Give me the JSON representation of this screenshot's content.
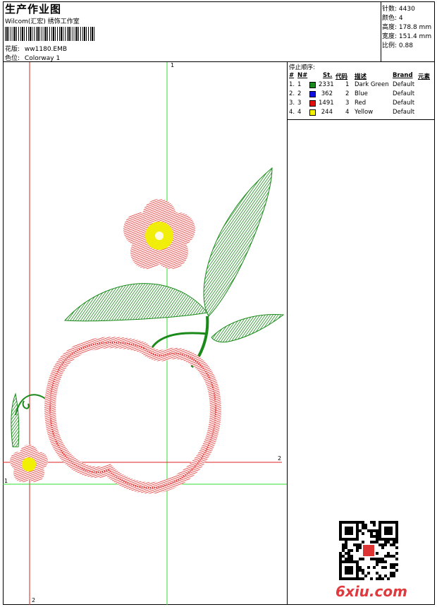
{
  "header": {
    "title": "生产作业图",
    "subtitle": "Wilcom(汇宏) 绣饰工作室",
    "design_label": "花版:",
    "design_value": "ww1180.EMB",
    "colorway_label": "色位:",
    "colorway_value": "Colorway 1"
  },
  "stats": {
    "stitches_label": "针数:",
    "stitches_value": "4430",
    "colors_label": "颜色:",
    "colors_value": "4",
    "height_label": "高度:",
    "height_value": "178.8 mm",
    "width_label": "宽度:",
    "width_value": "151.4 mm",
    "ratio_label": "比例:",
    "ratio_value": "0.88"
  },
  "stop_sequence": {
    "title": "停止顺序:",
    "columns": [
      "#",
      "N#",
      "St.",
      "代码",
      "描述",
      "Brand",
      "元素"
    ],
    "rows": [
      {
        "idx": "1.",
        "n": "1",
        "color": "#1a8a1a",
        "st": "2331",
        "code": "1",
        "desc": "Dark Green",
        "brand": "Default"
      },
      {
        "idx": "2.",
        "n": "2",
        "color": "#1010e0",
        "st": "362",
        "code": "2",
        "desc": "Blue",
        "brand": "Default"
      },
      {
        "idx": "3.",
        "n": "3",
        "color": "#e01010",
        "st": "1491",
        "code": "3",
        "desc": "Red",
        "brand": "Default"
      },
      {
        "idx": "4.",
        "n": "4",
        "color": "#f0f000",
        "st": "244",
        "code": "4",
        "desc": "Yellow",
        "brand": "Default"
      }
    ]
  },
  "guides": {
    "v1_label": "1",
    "h1_label": "1",
    "h2_label": "2",
    "v2_label": "2"
  },
  "watermark": {
    "site": "6xiu.com"
  },
  "colors": {
    "green": "#1a8a1a",
    "red": "#e01010",
    "yellow": "#f0f000",
    "guide_green": "#33dd33",
    "guide_red": "#dd2222"
  }
}
